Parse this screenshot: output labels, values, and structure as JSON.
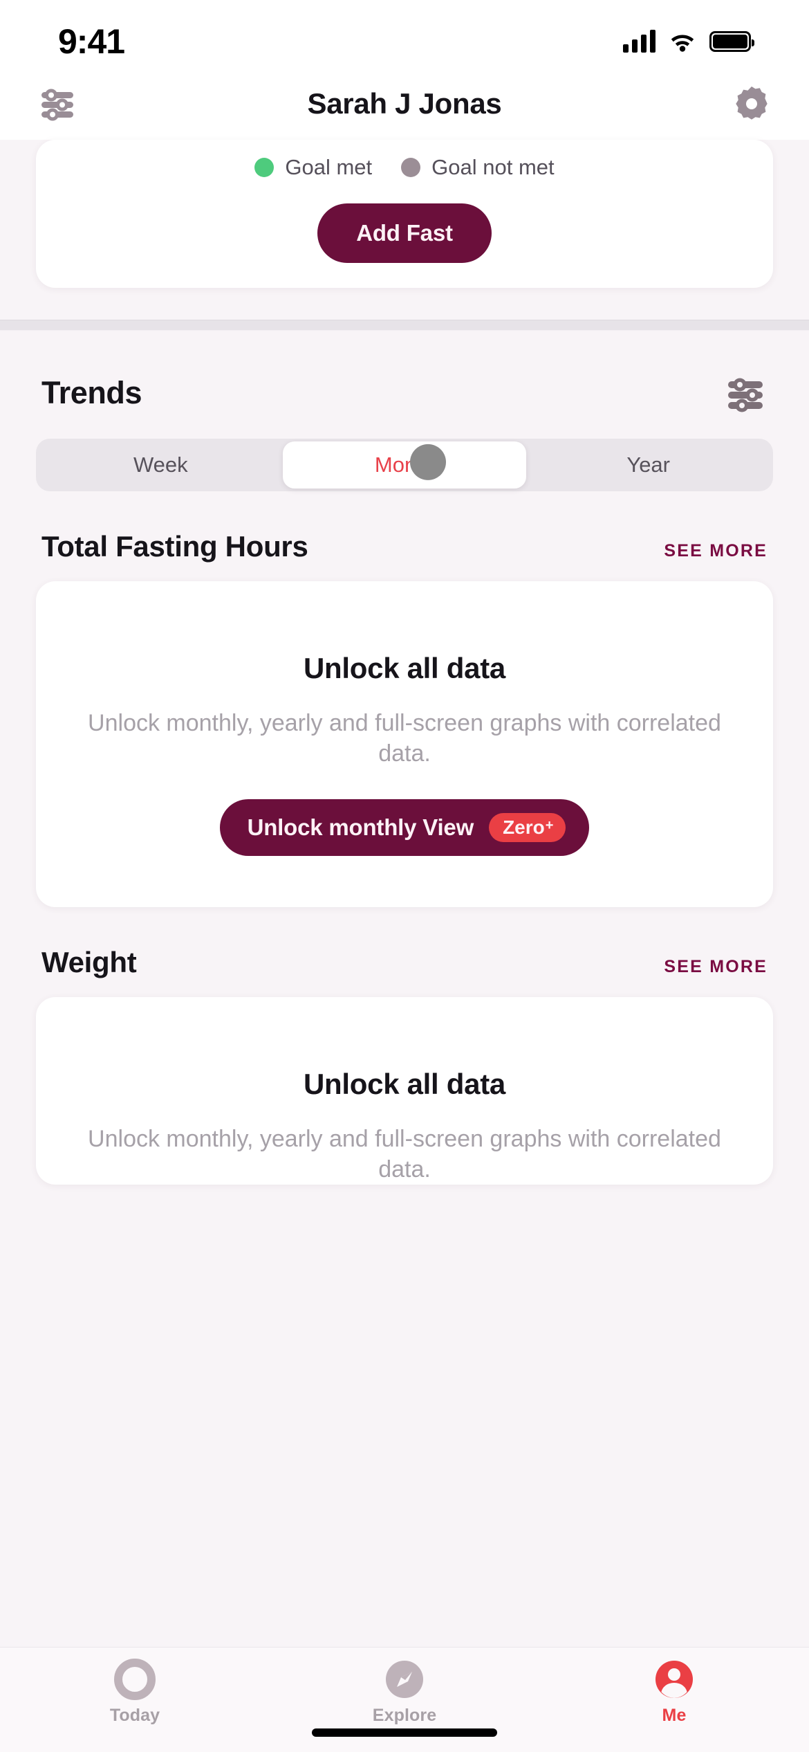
{
  "status_bar": {
    "time": "9:41",
    "cellular_icon": "signal-bars-icon",
    "wifi_icon": "wifi-icon",
    "battery_icon": "battery-full-icon"
  },
  "nav_bar": {
    "title": "Sarah J Jonas",
    "left_icon": "sliders-icon",
    "right_icon": "gear-icon"
  },
  "fasting_card": {
    "legend": [
      {
        "label": "Goal met",
        "color": "#4ecb7d"
      },
      {
        "label": "Goal not met",
        "color": "#9b8e96"
      }
    ],
    "add_fast_label": "Add Fast"
  },
  "trends": {
    "title": "Trends",
    "filter_icon": "sliders-icon",
    "range_tabs": [
      {
        "label": "Week",
        "selected": false
      },
      {
        "label": "Month",
        "selected": true
      },
      {
        "label": "Year",
        "selected": false
      }
    ],
    "selected_range": "Month"
  },
  "sections": [
    {
      "heading": "Total Fasting Hours",
      "see_more_label": "SEE MORE",
      "card": {
        "title": "Unlock all data",
        "description": "Unlock monthly, yearly and full-screen graphs with correlated data.",
        "cta_label": "Unlock monthly View",
        "badge_text": "Zero",
        "badge_superscript": "+"
      }
    },
    {
      "heading": "Weight",
      "see_more_label": "SEE MORE",
      "card": {
        "title": "Unlock all data",
        "description": "Unlock monthly, yearly and full-screen graphs with correlated data."
      }
    }
  ],
  "tab_bar": {
    "items": [
      {
        "label": "Today",
        "icon": "ring-icon",
        "active": false
      },
      {
        "label": "Explore",
        "icon": "compass-icon",
        "active": false
      },
      {
        "label": "Me",
        "icon": "person-icon",
        "active": true
      }
    ]
  },
  "colors": {
    "background": "#f8f4f7",
    "card": "#ffffff",
    "brand_maroon": "#6b0f3b",
    "accent_red": "#ea3f44",
    "see_more": "#7a0c42",
    "muted_text": "#a6a1a8",
    "icon_gray": "#7d7078"
  }
}
